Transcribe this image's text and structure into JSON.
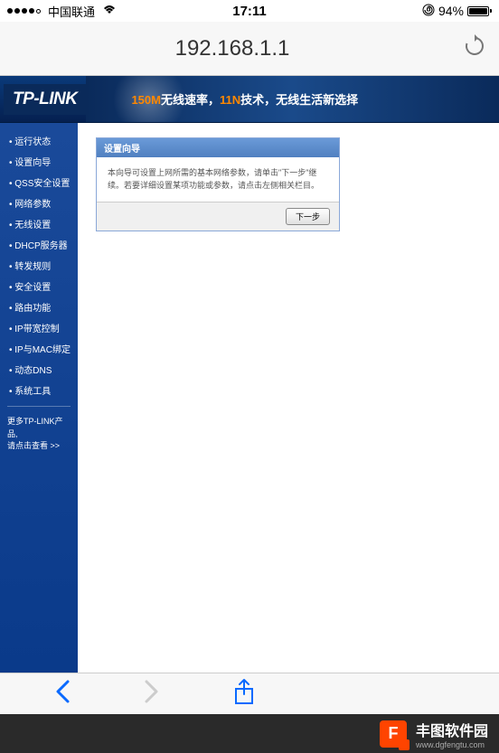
{
  "status": {
    "carrier": "中国联通",
    "time": "17:11",
    "battery_pct": "94%"
  },
  "browser": {
    "url": "192.168.1.1"
  },
  "router": {
    "logo": "TP-LINK",
    "banner_highlight": "150M",
    "banner_text1": "无线速率，",
    "banner_text2": "11N",
    "banner_text3": "技术，无线生活新选择",
    "menu": [
      "运行状态",
      "设置向导",
      "QSS安全设置",
      "网络参数",
      "无线设置",
      "DHCP服务器",
      "转发规则",
      "安全设置",
      "路由功能",
      "IP带宽控制",
      "IP与MAC绑定",
      "动态DNS",
      "系统工具"
    ],
    "sidebar_footer1": "更多TP-LINK产品,",
    "sidebar_footer2": "请点击查看 >>",
    "panel": {
      "title": "设置向导",
      "body": "本向导可设置上网所需的基本网络参数，请单击\"下一步\"继续。若要详细设置某项功能或参数，请点击左侧相关栏目。",
      "next": "下一步"
    }
  },
  "watermark": {
    "logo": "F",
    "title": "丰图软件园",
    "url": "www.dgfengtu.com"
  }
}
